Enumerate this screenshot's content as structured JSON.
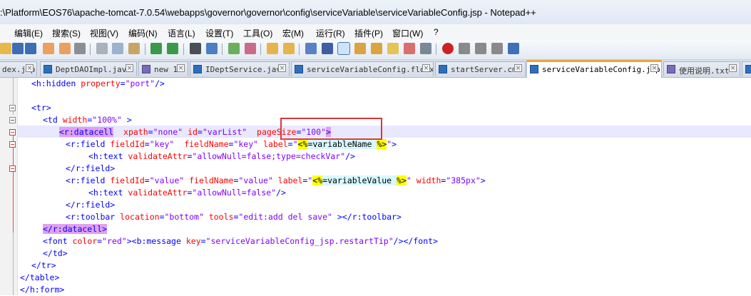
{
  "window": {
    "title": ":\\Platform\\EOS76\\apache-tomcat-7.0.54\\webapps\\governor\\governor\\config\\serviceVariable\\serviceVariableConfig.jsp - Notepad++"
  },
  "menu": {
    "items": [
      {
        "label": "编辑(E)"
      },
      {
        "label": "搜索(S)"
      },
      {
        "label": "视图(V)"
      },
      {
        "label": "编码(N)"
      },
      {
        "label": "语言(L)"
      },
      {
        "label": "设置(T)"
      },
      {
        "label": "工具(O)"
      },
      {
        "label": "宏(M)"
      },
      {
        "label": "运行(R)"
      },
      {
        "label": "插件(P)"
      },
      {
        "label": "窗口(W)"
      },
      {
        "label": "?"
      }
    ]
  },
  "toolbar": {
    "icons": [
      "open-file-icon",
      "save-icon",
      "save-all-icon",
      "close-icon",
      "close-all-icon",
      "print-icon",
      "cut-icon",
      "copy-icon",
      "paste-icon",
      "undo-icon",
      "redo-icon",
      "find-icon",
      "replace-icon",
      "zoom-in-icon",
      "zoom-out-icon",
      "sync-vertical-icon",
      "sync-horizontal-icon",
      "word-wrap-icon",
      "show-all-chars-icon",
      "indent-guide-icon",
      "user-language-icon",
      "function-list-icon",
      "folder-workspace-icon",
      "document-map-icon",
      "monitor-icon",
      "record-macro-icon",
      "stop-record-icon",
      "play-macro-icon",
      "run-macro-multiple-icon",
      "save-macro-icon"
    ]
  },
  "tabs": [
    {
      "label": "dex.jsp",
      "icon": "blue"
    },
    {
      "label": "DeptDAOImpl.java",
      "icon": "blue"
    },
    {
      "label": "new 1",
      "icon": "purple"
    },
    {
      "label": "IDeptService.java",
      "icon": "blue"
    },
    {
      "label": "serviceVariableConfig.flowx",
      "icon": "blue"
    },
    {
      "label": "startServer.cmd",
      "icon": "blue"
    },
    {
      "label": "serviceVariableConfig.jsp",
      "icon": "blue",
      "active": true
    },
    {
      "label": "使用说明.txt",
      "icon": "purple"
    }
  ],
  "editor": {
    "lines": {
      "l1_open": "<h:hidden ",
      "l1_attr": "property",
      "l1_eq": "=",
      "l1_val": "\"port\"",
      "l1_close": "/>",
      "l3": "<tr>",
      "l4_open": "<td ",
      "l4_attr": "width",
      "l4_eq": "=",
      "l4_val": "\"100%\"",
      "l4_close": " >",
      "l5_tag": "<r:datacell",
      "l5_attr1": "xpath",
      "l5_val1": "\"none\"",
      "l5_attr2": "id",
      "l5_val2": "\"varList\"",
      "l5_attr3": "pageSize",
      "l5_val3": "\"100\"",
      "l5_close": ">",
      "l6_open": "<r:field ",
      "l6_attr1": "fieldId",
      "l6_val1": "\"key\"",
      "l6_attr2": "fieldName",
      "l6_val2": "\"key\"",
      "l6_attr3": "label",
      "l6_q1": "\"",
      "l6_jsp_open": "<%",
      "l6_jsp_eq": "=",
      "l6_jsp_var": "variableName",
      "l6_jsp_close": "%>",
      "l6_q2": "\"",
      "l6_close": ">",
      "l7_open": "<h:text ",
      "l7_attr": "validateAttr",
      "l7_val": "\"allowNull=false;type=checkVar\"",
      "l7_close": "/>",
      "l8": "</r:field>",
      "l9_open": "<r:field ",
      "l9_attr1": "fieldId",
      "l9_val1": "\"value\"",
      "l9_attr2": "fieldName",
      "l9_val2": "\"value\"",
      "l9_attr3": "label",
      "l9_q1": "\"",
      "l9_jsp_open": "<%",
      "l9_jsp_eq": "=",
      "l9_jsp_var": "variableValue",
      "l9_jsp_close": "%>",
      "l9_q2": "\"",
      "l9_attr4": "width",
      "l9_val4": "\"385px\"",
      "l9_close": ">",
      "l10_open": "<h:text ",
      "l10_attr": "validateAttr",
      "l10_val": "\"allowNull=false\"",
      "l10_close": "/>",
      "l11": "</r:field>",
      "l12_open": "<r:toolbar ",
      "l12_attr1": "location",
      "l12_val1": "\"bottom\"",
      "l12_attr2": "tools",
      "l12_val2": "\"edit:add del save\"",
      "l12_close": " ></r:toolbar>",
      "l13": "</r:datacell>",
      "l14_open": "<font ",
      "l14_attr1": "color",
      "l14_val1": "\"red\"",
      "l14_mid": "><b:message ",
      "l14_attr2": "key",
      "l14_val2": "\"serviceVariableConfig_jsp.restartTip\"",
      "l14_close": "/></font>",
      "l15": "</td>",
      "l16": "</tr>",
      "l17": "</table>",
      "l18": "</h:form>"
    }
  }
}
